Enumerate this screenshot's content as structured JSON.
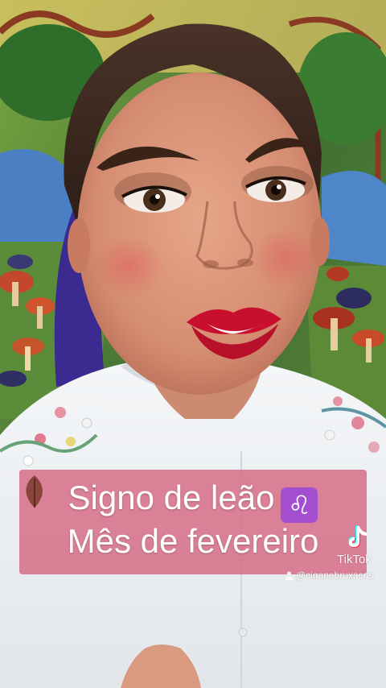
{
  "video": {
    "caption_line1": "Signo de leão",
    "caption_zodiac_symbol": "♌",
    "caption_line2": "Mês de fevereiro"
  },
  "watermark": {
    "brand": "TikTok",
    "username": "@ciganabruxacris",
    "logo_icon": "tiktok-note-icon",
    "user_icon": "person-icon"
  },
  "colors": {
    "caption_bg": "#d66882",
    "zodiac_bg": "#a44fd0",
    "lipstick": "#c8102e"
  }
}
